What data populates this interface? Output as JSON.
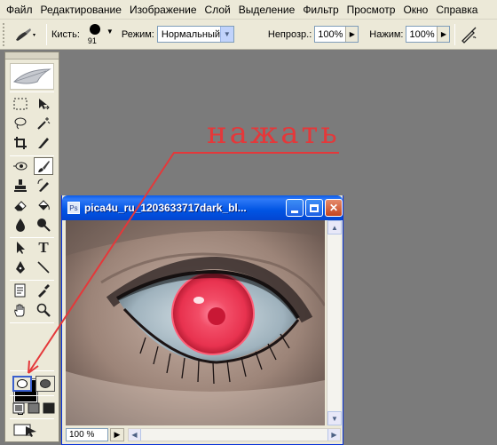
{
  "menu": [
    "Файл",
    "Редактирование",
    "Изображение",
    "Слой",
    "Выделение",
    "Фильтр",
    "Просмотр",
    "Окно",
    "Справка"
  ],
  "options": {
    "brush_label": "Кисть:",
    "brush_size": "91",
    "mode_label": "Режим:",
    "mode_value": "Нормальный",
    "opacity_label": "Непрозр.:",
    "opacity_value": "100%",
    "pressure_label": "Нажим:",
    "pressure_value": "100%"
  },
  "document": {
    "title": "pica4u_ru_1203633717dark_bl...",
    "zoom": "100 %"
  },
  "annotation": {
    "text": "нажать",
    "color": "#e4383a"
  },
  "colors": {
    "foreground": "#000000",
    "background": "#ffffff",
    "workspace": "#7b7b7b",
    "xp_title": "#0054e3"
  },
  "tools": [
    [
      "marquee-icon",
      "move-icon"
    ],
    [
      "lasso-icon",
      "magic-wand-icon"
    ],
    [
      "crop-icon",
      "slice-icon"
    ],
    [
      "healing-brush-icon",
      "brush-icon"
    ],
    [
      "clone-stamp-icon",
      "history-brush-icon"
    ],
    [
      "eraser-icon",
      "paint-bucket-icon"
    ],
    [
      "blur-icon",
      "dodge-icon"
    ],
    [
      "path-selection-icon",
      "type-icon"
    ],
    [
      "pen-icon",
      "line-icon"
    ],
    [
      "notes-icon",
      "eyedropper-icon"
    ],
    [
      "hand-icon",
      "zoom-icon"
    ]
  ]
}
